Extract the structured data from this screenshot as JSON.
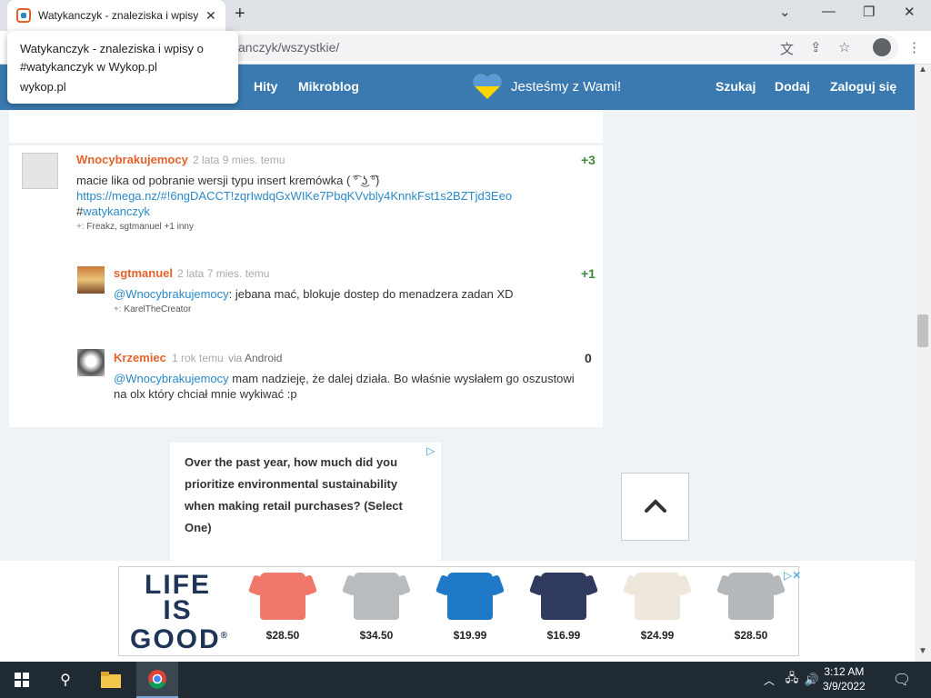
{
  "browser": {
    "tab_title": "Watykanczyk - znaleziska i wpisy",
    "tab_close": "✕",
    "new_tab": "+",
    "url_visible": "anczyk/wszystkie/",
    "tooltip": {
      "title": "Watykanczyk - znaleziska i wpisy o #watykanczyk w Wykop.pl",
      "domain": "wykop.pl"
    }
  },
  "site_nav": {
    "hity": "Hity",
    "mikroblog": "Mikroblog",
    "banner": "Jesteśmy z Wami!",
    "szukaj": "Szukaj",
    "dodaj": "Dodaj",
    "zaloguj": "Zaloguj się"
  },
  "comments": {
    "main": {
      "author": "Wnocybrakujemocy",
      "date": "2 lata 9 mies. temu",
      "score": "+3",
      "text": "macie lika od pobranie wersji typu insert kremówka ( ͡° ͜ʖ ͡°)",
      "link": "https://mega.nz/#!6ngDACCT!zqrIwdqGxWIKe7PbqKVvbly4KnnkFst1s2BZTjd3Eeo",
      "tag_hash": "#",
      "tag": "watykanczyk",
      "plus_prefix": "+:",
      "plus_names": "Freakz, sgtmanuel +1 inny"
    },
    "reply1": {
      "author": "sgtmanuel",
      "date": "2 lata 7 mies. temu",
      "score": "+1",
      "mention": "@Wnocybrakujemocy",
      "text": ": jebana mać, blokuje dostep do menadzera zadan XD",
      "plus_prefix": "+:",
      "plus_names": "KarelTheCreator"
    },
    "reply2": {
      "author": "Krzemiec",
      "date": "1 rok temu",
      "via": "via",
      "via_app": "Android",
      "score": "0",
      "mention": "@Wnocybrakujemocy",
      "text_line1": " mam nadzieję, że dalej działa. Bo właśnie wysłałem go oszustowi",
      "text_line2": "na olx który chciał mnie wykiwać :p"
    }
  },
  "ad_survey": {
    "question": "Over the past year, how much did you prioritize environmental sustainability when making retail purchases? (Select One)"
  },
  "bottom_ad": {
    "logo_lines": [
      "LIFE",
      "IS",
      "GOOD"
    ],
    "logo_mark": "®",
    "products": [
      {
        "price": "$28.50",
        "color": "#f0786a"
      },
      {
        "price": "$34.50",
        "color": "#b9bcbf"
      },
      {
        "price": "$19.99",
        "color": "#1f78c8"
      },
      {
        "price": "$16.99",
        "color": "#2f3a5e"
      },
      {
        "price": "$24.99",
        "color": "#eee8dc"
      },
      {
        "price": "$28.50",
        "color": "#b5b8bb"
      }
    ]
  },
  "taskbar": {
    "time": "3:12 AM",
    "date": "3/9/2022"
  },
  "colors": {
    "header": "#3b7ab0",
    "author": "#e5622b",
    "score": "#3c8b3c",
    "link": "#2a8ac7"
  }
}
